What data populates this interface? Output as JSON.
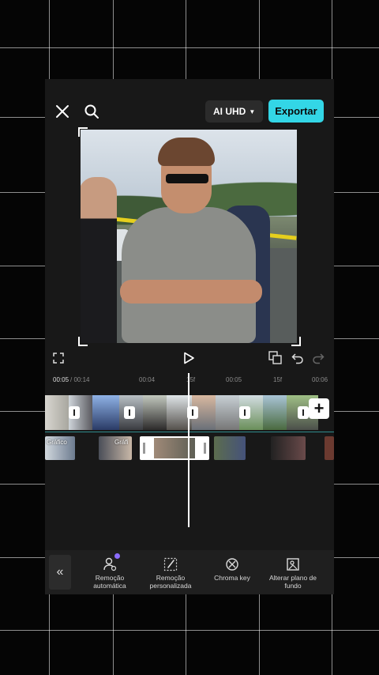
{
  "header": {
    "close_icon": "close-icon",
    "search_icon": "search-icon",
    "quality_label": "AI UHD",
    "export_label": "Exportar"
  },
  "colors": {
    "accent": "#33d6e6",
    "panel": "#181818",
    "track_line": "#2f8c8d"
  },
  "player": {
    "current_time": "00:05",
    "total_time": "/ 00:14",
    "ruler_marks": [
      "00:04",
      "15f",
      "00:05",
      "15f",
      "00:06"
    ],
    "controls": [
      "fullscreen-icon",
      "play-icon",
      "keyframe-icon",
      "undo-icon",
      "redo-icon"
    ]
  },
  "timeline": {
    "overlay_labels": [
      "Gráfico",
      "Gráfi"
    ]
  },
  "toolbar": {
    "items": [
      {
        "label": "Remoção automática",
        "icon": "person-remove-icon"
      },
      {
        "label": "Remoção personalizada",
        "icon": "brush-icon"
      },
      {
        "label": "Chroma key",
        "icon": "chroma-key-icon"
      },
      {
        "label": "Alterar plano de fundo",
        "icon": "background-icon"
      }
    ]
  }
}
